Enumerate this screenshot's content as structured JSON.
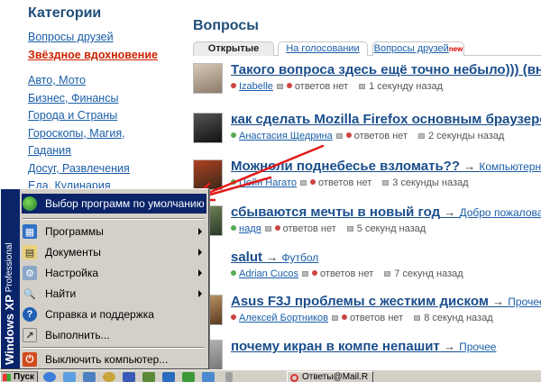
{
  "sidebar": {
    "title": "Категории",
    "links_top": [
      "Вопросы друзей",
      "Звёздное вдохновение"
    ],
    "links": [
      "Авто, Мото",
      "Бизнес, Финансы",
      "Города и Страны",
      "Гороскопы, Магия,",
      "Гадания",
      "Досуг, Развлечения",
      "Еда, Кулинария"
    ]
  },
  "main": {
    "title": "Вопросы",
    "tabs": [
      {
        "label": "Открытые",
        "active": true
      },
      {
        "label": "На голосовании",
        "active": false
      },
      {
        "label": "Вопросы друзей",
        "badge": "new",
        "active": false
      }
    ]
  },
  "questions": [
    {
      "title": "Такого вопроса здесь ещё точно небыло))) (вну",
      "category": "",
      "user": "Izabelle",
      "answers": "ответов нет",
      "time": "1 секунду назад"
    },
    {
      "title": "как сделать Mozilla Firefox основным браузером",
      "category": "",
      "user": "Анастасия Щедрина",
      "answers": "ответов нет",
      "time": "2 секунды назад"
    },
    {
      "title": "Можноли поднебесье взломать??",
      "category": "Компьютерные",
      "user": "Пейн Нагато",
      "answers": "ответов нет",
      "time": "3 секунды назад"
    },
    {
      "title": "сбываются мечты в новый год",
      "category": "Добро пожаловат",
      "user": "надя",
      "answers": "ответов нет",
      "time": "5 секунд назад"
    },
    {
      "title": "salut",
      "category": "Футбол",
      "user": "Adrian Cucos",
      "answers": "ответов нет",
      "time": "7 секунд назад"
    },
    {
      "title": "Asus F3J проблемы с жестким диском",
      "category": "Прочее в",
      "user": "Алексей Бортников",
      "answers": "ответов нет",
      "time": "8 секунд назад"
    },
    {
      "title": "почему икран в компе непашит",
      "category": "Прочее",
      "user": "",
      "answers": "",
      "time": ""
    }
  ],
  "start_menu": {
    "banner_bold": "Windows XP",
    "banner_light": "Professional",
    "items": [
      {
        "label": "Выбор программ по умолчанию",
        "icon": "default-programs-icon",
        "submenu": false,
        "selected": true
      },
      {
        "label": "Программы",
        "icon": "programs-icon",
        "submenu": true
      },
      {
        "label": "Документы",
        "icon": "documents-icon",
        "submenu": true
      },
      {
        "label": "Настройка",
        "icon": "settings-icon",
        "submenu": true
      },
      {
        "label": "Найти",
        "icon": "search-icon",
        "submenu": true
      },
      {
        "label": "Справка и поддержка",
        "icon": "help-icon",
        "submenu": false
      },
      {
        "label": "Выполнить...",
        "icon": "run-icon",
        "submenu": false
      },
      {
        "label": "Выключить компьютер...",
        "icon": "shutdown-icon",
        "submenu": false
      }
    ]
  },
  "taskbar": {
    "start_label": "Пуск",
    "task_label": "Ответы@Mail.R"
  },
  "colors": {
    "menu_bg": "#d4d0c8",
    "selection": "#0a246a",
    "link": "#1a5ea8",
    "annotation_arrow": "#e21a1a"
  }
}
